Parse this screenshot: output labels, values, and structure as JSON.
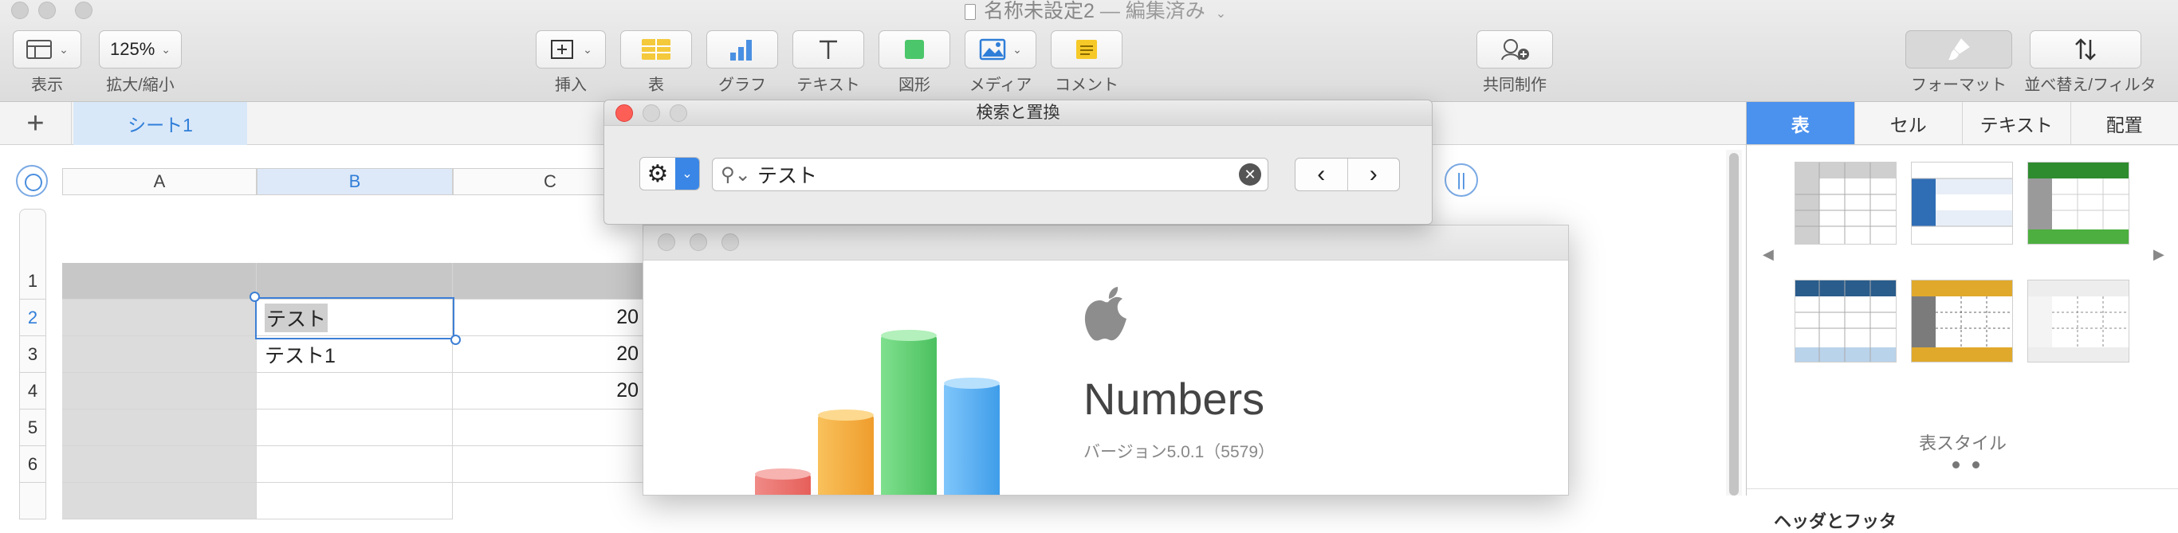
{
  "window": {
    "title": "名称未設定2",
    "title_suffix": "— 編集済み"
  },
  "toolbar": {
    "view_label": "表示",
    "zoom_value": "125%",
    "zoom_label": "拡大/縮小",
    "insert_label": "挿入",
    "table_label": "表",
    "chart_label": "グラフ",
    "text_label": "テキスト",
    "shape_label": "図形",
    "media_label": "メディア",
    "comment_label": "コメント",
    "collaborate_label": "共同制作",
    "format_label": "フォーマット",
    "sort_filter_label": "並べ替え/フィルタ"
  },
  "sheets": {
    "add_label": "+",
    "tabs": [
      "シート1"
    ]
  },
  "spreadsheet": {
    "columns": [
      "A",
      "B",
      "C"
    ],
    "rows": [
      "1",
      "2",
      "3",
      "4",
      "5",
      "6"
    ],
    "cells": {
      "B2": "テスト",
      "B3": "テスト1",
      "C2": "20",
      "C3": "20",
      "C4": "20"
    }
  },
  "find_replace": {
    "title": "検索と置換",
    "search_value": "テスト",
    "clear_glyph": "✕",
    "prev_glyph": "‹",
    "next_glyph": "›"
  },
  "about": {
    "app_name": "Numbers",
    "version": "バージョン5.0.1（5579）"
  },
  "inspector": {
    "tabs": [
      "表",
      "セル",
      "テキスト",
      "配置"
    ],
    "active_tab": "表",
    "table_styles_label": "表スタイル",
    "header_footer_label": "ヘッダとフッタ"
  },
  "colors": {
    "accent": "#4b91ee",
    "selection": "#3d7fd6",
    "close_button": "#fd5f57"
  }
}
